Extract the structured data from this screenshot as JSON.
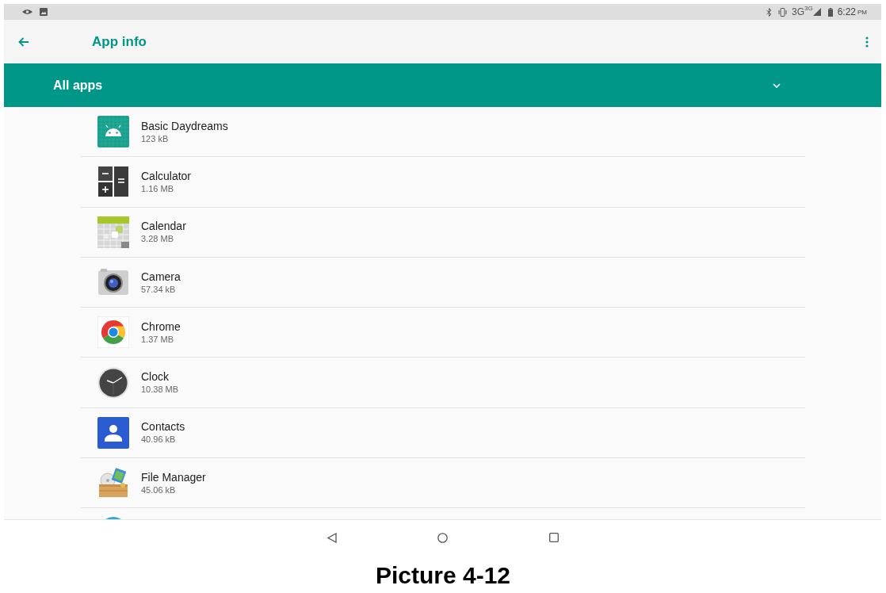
{
  "status_bar": {
    "network": "3G",
    "network_badge": "3G",
    "time": "6:22",
    "time_suffix": "PM"
  },
  "app_bar": {
    "title": "App info"
  },
  "filter": {
    "label": "All apps"
  },
  "apps": [
    {
      "name": "Basic Daydreams",
      "size": "123 kB"
    },
    {
      "name": "Calculator",
      "size": "1.16 MB"
    },
    {
      "name": "Calendar",
      "size": "3.28 MB"
    },
    {
      "name": "Camera",
      "size": "57.34 kB"
    },
    {
      "name": "Chrome",
      "size": "1.37 MB"
    },
    {
      "name": "Clock",
      "size": "10.38 MB"
    },
    {
      "name": "Contacts",
      "size": "40.96 kB"
    },
    {
      "name": "File Manager",
      "size": "45.06 kB"
    }
  ],
  "caption": "Picture 4-12"
}
